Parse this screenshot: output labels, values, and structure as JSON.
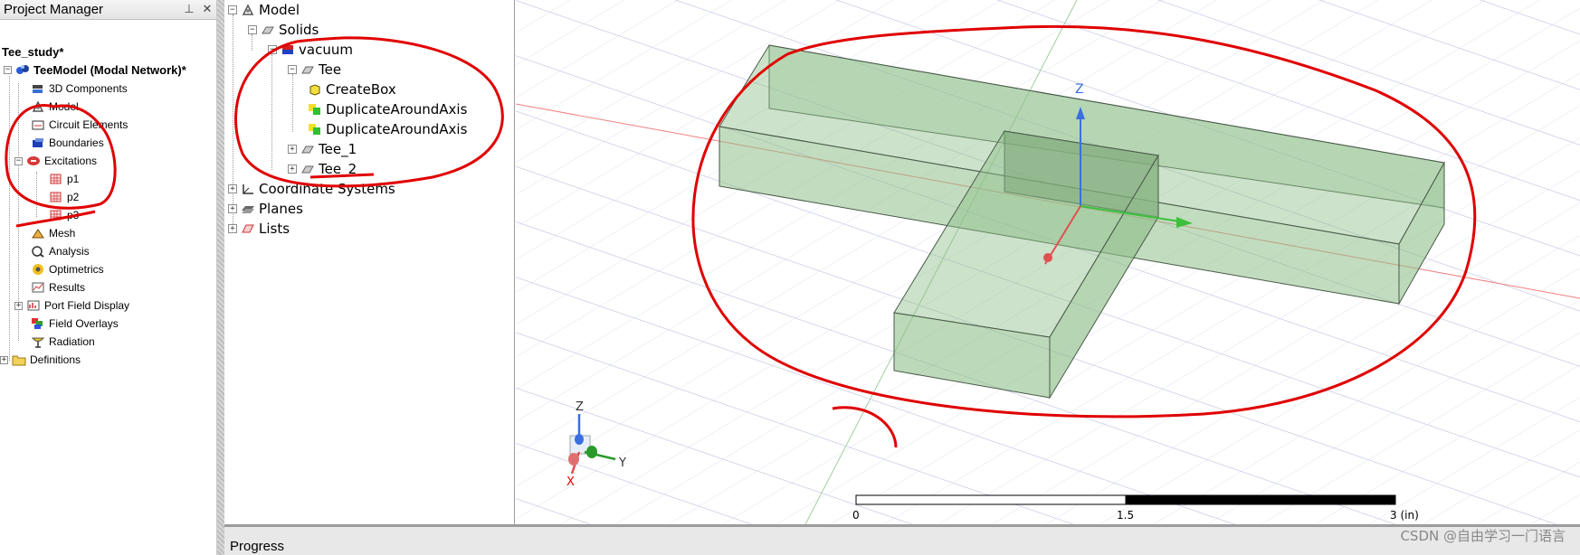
{
  "project_manager": {
    "title": "Project Manager",
    "pin_icon": "pin-icon",
    "close_icon": "close-icon",
    "tree": [
      {
        "label": "Tee_study*",
        "bold": true
      },
      {
        "label": "TeeModel (Modal Network)*",
        "bold": true
      },
      {
        "label": "3D Components"
      },
      {
        "label": "Model"
      },
      {
        "label": "Circuit Elements"
      },
      {
        "label": "Boundaries"
      },
      {
        "label": "Excitations"
      },
      {
        "label": "p1"
      },
      {
        "label": "p2"
      },
      {
        "label": "p3"
      },
      {
        "label": "Mesh"
      },
      {
        "label": "Analysis"
      },
      {
        "label": "Optimetrics"
      },
      {
        "label": "Results"
      },
      {
        "label": "Port Field Display"
      },
      {
        "label": "Field Overlays"
      },
      {
        "label": "Radiation"
      },
      {
        "label": "Definitions"
      }
    ]
  },
  "model_tree": {
    "items": [
      {
        "label": "Model"
      },
      {
        "label": "Solids"
      },
      {
        "label": "vacuum"
      },
      {
        "label": "Tee"
      },
      {
        "label": "CreateBox"
      },
      {
        "label": "DuplicateAroundAxis"
      },
      {
        "label": "DuplicateAroundAxis"
      },
      {
        "label": "Tee_1"
      },
      {
        "label": "Tee_2"
      },
      {
        "label": "Coordinate Systems"
      },
      {
        "label": "Planes"
      },
      {
        "label": "Lists"
      }
    ]
  },
  "viewport": {
    "axis_z_label": "Z",
    "triad_z": "Z",
    "triad_y": "Y",
    "triad_x": "X",
    "scale_labels": [
      "0",
      "1.5",
      "3 (in)"
    ],
    "annotation_color": "#e00000",
    "solid_color": "#8fbf8a"
  },
  "status": {
    "progress_label": "Progress",
    "watermark": "CSDN @自由学习一门语言"
  }
}
